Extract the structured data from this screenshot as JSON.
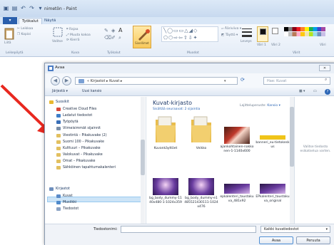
{
  "paint": {
    "title": "nimetön - Paint",
    "menu_button": "▾",
    "tabs": [
      "Työkalut",
      "Näytä"
    ],
    "groups": [
      "Leikepöytä",
      "Kuva",
      "Työkalut",
      "Muodot",
      "Värit"
    ],
    "clipboard": {
      "paste": "Liitä",
      "cut": "Leikkaa",
      "copy": "Kopioi"
    },
    "image": {
      "select": "Valitse",
      "crop": "Rajaa",
      "resize": "Muuta kokoa",
      "rotate": "Kierrä"
    },
    "tools_label": "Sivellimet",
    "shapes": {
      "outline": "Ääriviiva",
      "fill": "Täyttö"
    },
    "size_label": "Leveys",
    "color1": "Väri 1",
    "color2": "Väri 2",
    "edit_colors": "Väri"
  },
  "dialog": {
    "title": "Avaa",
    "close": "✕",
    "address": "« Kirjastot ▸ Kuvat ▸",
    "search_placeholder": "Hae: Kuvat",
    "toolbar": {
      "organize": "Järjestä ▾",
      "new_folder": "Uusi kansio"
    },
    "nav_items": [
      {
        "label": "Suosikit",
        "type": "head",
        "color": "#e8b830"
      },
      {
        "label": "Creative Cloud Files",
        "type": "sub",
        "color": "#d8473a"
      },
      {
        "label": "Ladatut tiedostot",
        "type": "sub",
        "color": "#3d7ec9"
      },
      {
        "label": "Työpöytä",
        "type": "sub",
        "color": "#3a6fb8"
      },
      {
        "label": "Viimeisimmät sijainnit",
        "type": "sub",
        "color": "#7a8ea8"
      },
      {
        "label": "Viestintä – Pikakuvake (2)",
        "type": "sub",
        "color": "#e2c060"
      },
      {
        "label": "Suomi 100 – Pikakuvake",
        "type": "sub",
        "color": "#e2c060"
      },
      {
        "label": "Kulttuuri – Pikakuvake",
        "type": "sub",
        "color": "#e2c060"
      },
      {
        "label": "Valokuvat – Pikakuvake",
        "type": "sub",
        "color": "#e2c060"
      },
      {
        "label": "Omat – Pikakuvake",
        "type": "sub",
        "color": "#e2c060"
      },
      {
        "label": "Sähköinen tapahtumakalenteri",
        "type": "sub",
        "color": "#e2c060"
      },
      {
        "label": "Kirjastot",
        "type": "head",
        "color": "#6e8fbd"
      },
      {
        "label": "Kuvat",
        "type": "sub",
        "color": "#5b8bc8"
      },
      {
        "label": "Musiikki",
        "type": "sub",
        "color": "#4f8acb"
      },
      {
        "label": "Tiedostot",
        "type": "sub",
        "color": "#8aa2c4"
      }
    ],
    "library_title": "Kuvat-kirjasto",
    "library_subtitle": "Sisältää seuraavat: 2 sijaintia",
    "arrange_label": "Lajitteluperuste:",
    "arrange_value": "Kansio ▾",
    "files": [
      {
        "caption": "Kuvankäyttöet",
        "kind": "folder"
      },
      {
        "caption": "Veikko",
        "kind": "folder"
      },
      {
        "caption": "ajankohtainen-nakkonen-1-1140x600",
        "kind": "photo-dark"
      },
      {
        "caption": "banneri_eu-tietokeskus",
        "kind": "photo-yellow"
      },
      {
        "caption": "bg_body_dummy-1140x480-1-1024x359",
        "kind": "photo-purple"
      },
      {
        "caption": "bg_body_dummy-e1485521430111-1024x476",
        "kind": "photo-purple"
      },
      {
        "caption": "epkalenteri_taustakuva_481x92",
        "kind": "photo-purple-dark"
      },
      {
        "caption": "EPkalenteri_taustakuva_original",
        "kind": "photo-purple-dark"
      }
    ],
    "preview_text": "Valitse tiedosto esikatselua varten.",
    "filename_label": "Tiedostonimi:",
    "filename_value": "",
    "filetype": "Kaikki kuvatiedostot",
    "open_button": "Avaa",
    "cancel_button": "Peruuta"
  },
  "colors": {
    "arrow": "#e8281f",
    "selection": "#cce4f7",
    "folder": "#e9bd4c",
    "photo_purple": "#6a3da0",
    "photo_dark": "#4a1e14",
    "photo_yellow": "#f0c419"
  }
}
